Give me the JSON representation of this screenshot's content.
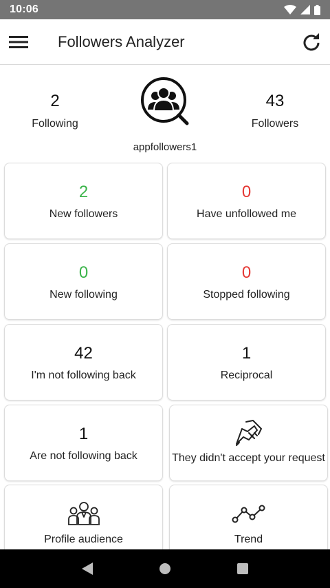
{
  "status": {
    "time": "10:06"
  },
  "app_bar": {
    "title": "Followers Analyzer"
  },
  "profile": {
    "following_count": "2",
    "following_label": "Following",
    "followers_count": "43",
    "followers_label": "Followers",
    "username": "appfollowers1"
  },
  "cards": {
    "new_followers": {
      "value": "2",
      "label": "New followers"
    },
    "unfollowed_me": {
      "value": "0",
      "label": "Have unfollowed me"
    },
    "new_following": {
      "value": "0",
      "label": "New following"
    },
    "stopped_following": {
      "value": "0",
      "label": "Stopped following"
    },
    "not_following_back": {
      "value": "42",
      "label": "I'm not following back"
    },
    "reciprocal": {
      "value": "1",
      "label": "Reciprocal"
    },
    "are_not_following_back": {
      "value": "1",
      "label": "Are not following back"
    },
    "request_not_accepted": {
      "label": "They didn't accept your request",
      "icon": "handshake-icon"
    },
    "profile_audience": {
      "label": "Profile audience",
      "icon": "audience-icon"
    },
    "trend": {
      "label": "Trend",
      "icon": "trend-icon"
    }
  },
  "colors": {
    "positive": "#3cb44b",
    "negative": "#e53935",
    "status_bar": "#757575"
  }
}
